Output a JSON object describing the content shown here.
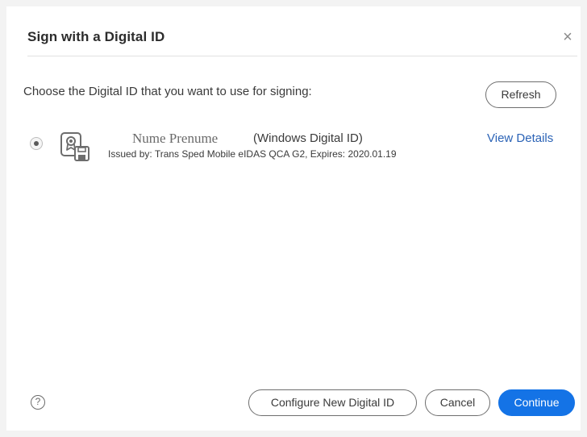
{
  "dialog": {
    "title": "Sign with a Digital ID",
    "close_symbol": "×",
    "prompt": "Choose the Digital ID that you want to use for signing:",
    "refresh_label": "Refresh"
  },
  "digital_id": {
    "selected": true,
    "icon": "certificate-floppy-icon",
    "name": "Nume Prenume",
    "type": "(Windows Digital ID)",
    "issued": "Issued by: Trans Sped Mobile eIDAS QCA G2, Expires: 2020.01.19",
    "view_details_label": "View Details"
  },
  "footer": {
    "help_symbol": "?",
    "configure_label": "Configure New Digital ID",
    "cancel_label": "Cancel",
    "continue_label": "Continue"
  },
  "colors": {
    "primary_button": "#1473e6",
    "link": "#2b63b6"
  }
}
